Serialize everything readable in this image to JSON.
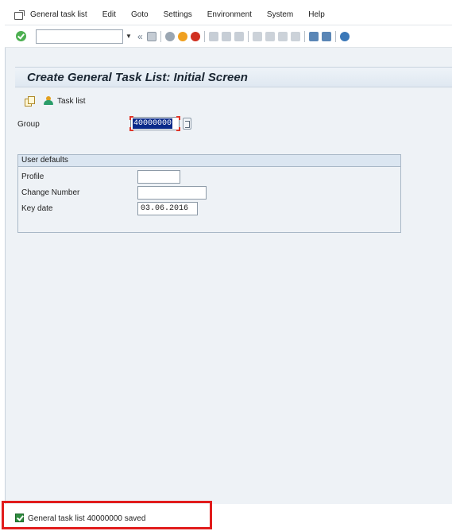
{
  "menu": {
    "items": [
      "General task list",
      "Edit",
      "Goto",
      "Settings",
      "Environment",
      "System",
      "Help"
    ]
  },
  "toolbar": {
    "command_field_value": "",
    "icons": [
      "ok-icon",
      "command-dropdown-icon",
      "back-chevron-icon",
      "save-icon",
      "back-icon",
      "exit-icon",
      "cancel-icon",
      "print-icon",
      "find-icon",
      "find-next-icon",
      "first-page-icon",
      "previous-page-icon",
      "next-page-icon",
      "last-page-icon",
      "create-session-icon",
      "shortcut-icon",
      "help-icon"
    ],
    "colors": {
      "ok": "#4caf50",
      "exit": "#f0a020",
      "cancel": "#d03020"
    }
  },
  "title": "Create General Task List: Initial Screen",
  "app_toolbar": {
    "task_list_label": "Task list"
  },
  "group": {
    "label": "Group",
    "value": "40000000"
  },
  "user_defaults": {
    "header": "User defaults",
    "fields": [
      {
        "label": "Profile",
        "value": ""
      },
      {
        "label": "Change Number",
        "value": ""
      },
      {
        "label": "Key date",
        "value": "03.06.2016"
      }
    ]
  },
  "status": {
    "message": "General task list 40000000 saved",
    "type": "success"
  }
}
